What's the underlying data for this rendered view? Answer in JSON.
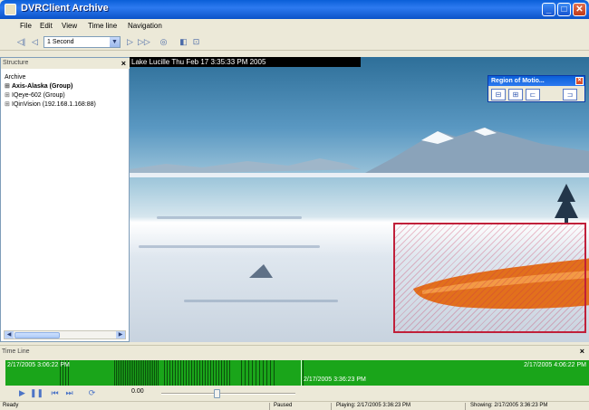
{
  "window": {
    "title": "DVRClient Archive"
  },
  "menu": [
    "File",
    "Edit",
    "View",
    "Time line",
    "Navigation"
  ],
  "toolbar": {
    "speed": "1 Second"
  },
  "structure": {
    "header": "Structure",
    "items": [
      "Archive",
      "Axis-Alaska (Group)",
      "IQeye-602 (Group)",
      "IQinVision (192.168.1.168:88)"
    ]
  },
  "video": {
    "osd": "Lake Lucille  Thu Feb 17  3:35:33 PM  2005",
    "region_dialog_title": "Region of Motio..."
  },
  "timeline": {
    "header": "Time Line",
    "start": "2/17/2005 3:06:22 PM",
    "current": "2/17/2005 3:36:23 PM",
    "end": "2/17/2005 4:06:22 PM"
  },
  "playback": {
    "position": "0.00",
    "slider_fraction": 0.42
  },
  "status": {
    "ready": "Ready",
    "paused": "Paused",
    "playing": "Playing: 2/17/2005 3:36:23 PM",
    "showing": "Showing: 2/17/2005 3:36:23 PM"
  },
  "colors": {
    "titlebar": "#0a5fd8",
    "timeline": "#1aa51a",
    "region": "#c0203a"
  }
}
